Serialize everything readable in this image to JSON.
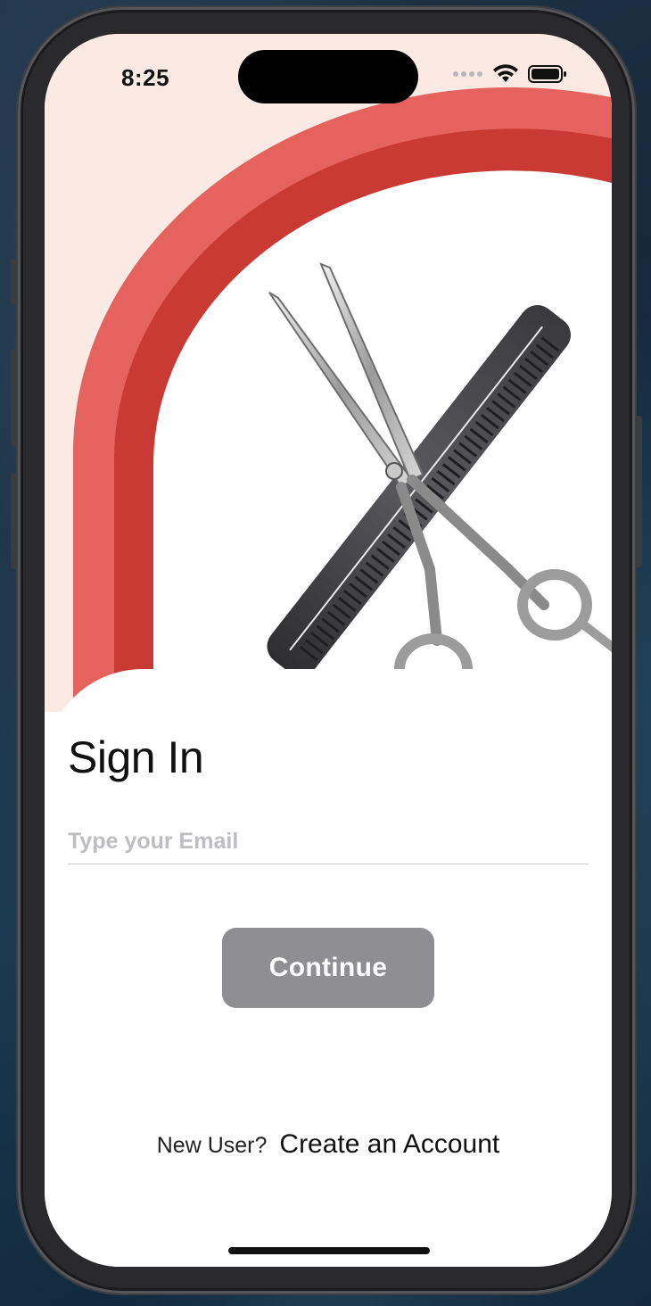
{
  "status_bar": {
    "time": "8:25",
    "icons": [
      "cellular-dots-icon",
      "wifi-icon",
      "battery-icon"
    ]
  },
  "hero": {
    "image": "scissors-and-comb-icon",
    "colors": {
      "background": "#fbe9e4",
      "arch_outer": "#e6625e",
      "arch_inner": "#c83a33"
    }
  },
  "sign_in": {
    "title": "Sign In",
    "email_placeholder": "Type your Email",
    "email_value": "",
    "continue_label": "Continue"
  },
  "footer": {
    "prompt": "New User?",
    "link_label": "Create an Account"
  },
  "colors": {
    "button": "#8e8e93",
    "placeholder": "#bdbdc2"
  }
}
